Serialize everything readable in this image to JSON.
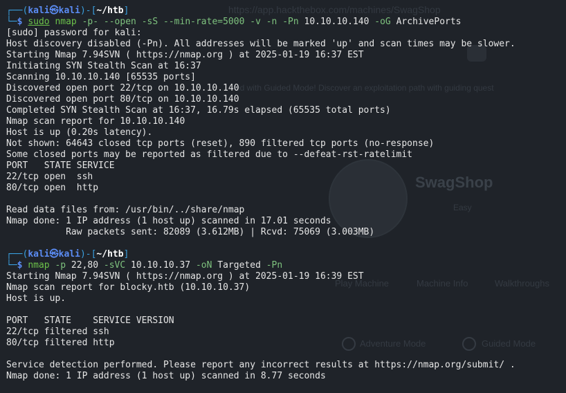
{
  "background_page": {
    "url": "https://app.hackthebox.com/machines/SwagShop",
    "guided_text": "ed with Guided Mode! Discover an exploitation path with guiding quest",
    "machine_name": "SwagShop",
    "difficulty": "Easy",
    "tabs": [
      "Play Machine",
      "Machine Info",
      "Walkthroughs"
    ],
    "modes": [
      "Adventure Mode",
      "Guided Mode"
    ]
  },
  "session1": {
    "prompt_top": "┌──(",
    "user": "kali㉿kali",
    "prompt_mid": ")-[",
    "path": "~/htb",
    "prompt_end": "]",
    "prompt_bottom": "└─",
    "dollar": "$ ",
    "sudo": "sudo",
    "cmd": "nmap",
    "args": [
      {
        "t": " -p-",
        "k": "opt"
      },
      {
        "t": " --open",
        "k": "opt"
      },
      {
        "t": " -sS",
        "k": "opt"
      },
      {
        "t": " --min-rate=5000",
        "k": "opt"
      },
      {
        "t": " -v",
        "k": "opt"
      },
      {
        "t": " -n",
        "k": "opt"
      },
      {
        "t": " -Pn",
        "k": "opt"
      },
      {
        "t": " 10.10.10.140",
        "k": "arg"
      },
      {
        "t": " -oG",
        "k": "opt"
      },
      {
        "t": " ArchivePorts",
        "k": "arg"
      }
    ],
    "output": [
      "[sudo] password for kali:",
      "Host discovery disabled (-Pn). All addresses will be marked 'up' and scan times may be slower.",
      "Starting Nmap 7.94SVN ( https://nmap.org ) at 2025-01-19 16:37 EST",
      "Initiating SYN Stealth Scan at 16:37",
      "Scanning 10.10.10.140 [65535 ports]",
      "Discovered open port 22/tcp on 10.10.10.140",
      "Discovered open port 80/tcp on 10.10.10.140",
      "Completed SYN Stealth Scan at 16:37, 16.79s elapsed (65535 total ports)",
      "Nmap scan report for 10.10.10.140",
      "Host is up (0.20s latency).",
      "Not shown: 64643 closed tcp ports (reset), 890 filtered tcp ports (no-response)",
      "Some closed ports may be reported as filtered due to --defeat-rst-ratelimit",
      "PORT   STATE SERVICE",
      "22/tcp open  ssh",
      "80/tcp open  http",
      "",
      "Read data files from: /usr/bin/../share/nmap",
      "Nmap done: 1 IP address (1 host up) scanned in 17.01 seconds",
      "           Raw packets sent: 82089 (3.612MB) | Rcvd: 75069 (3.003MB)",
      ""
    ]
  },
  "session2": {
    "prompt_top": "┌──(",
    "user": "kali㉿kali",
    "prompt_mid": ")-[",
    "path": "~/htb",
    "prompt_end": "]",
    "prompt_bottom": "└─",
    "dollar": "$ ",
    "cmd": "nmap",
    "args": [
      {
        "t": " -p",
        "k": "opt"
      },
      {
        "t": " 22,80",
        "k": "arg"
      },
      {
        "t": " -sVC",
        "k": "opt"
      },
      {
        "t": " 10.10.10.37",
        "k": "arg"
      },
      {
        "t": " -oN",
        "k": "opt"
      },
      {
        "t": " Targeted",
        "k": "arg"
      },
      {
        "t": " -Pn",
        "k": "opt"
      }
    ],
    "output": [
      "Starting Nmap 7.94SVN ( https://nmap.org ) at 2025-01-19 16:39 EST",
      "Nmap scan report for blocky.htb (10.10.10.37)",
      "Host is up.",
      "",
      "PORT   STATE    SERVICE VERSION",
      "22/tcp filtered ssh",
      "80/tcp filtered http",
      "",
      "Service detection performed. Please report any incorrect results at https://nmap.org/submit/ .",
      "Nmap done: 1 IP address (1 host up) scanned in 8.77 seconds"
    ]
  },
  "colors": {
    "background": "#1f2329",
    "prompt_user": "#5b8cf4",
    "command": "#6cc24a",
    "option": "#7ec27e",
    "text": "#e6e6e6"
  }
}
